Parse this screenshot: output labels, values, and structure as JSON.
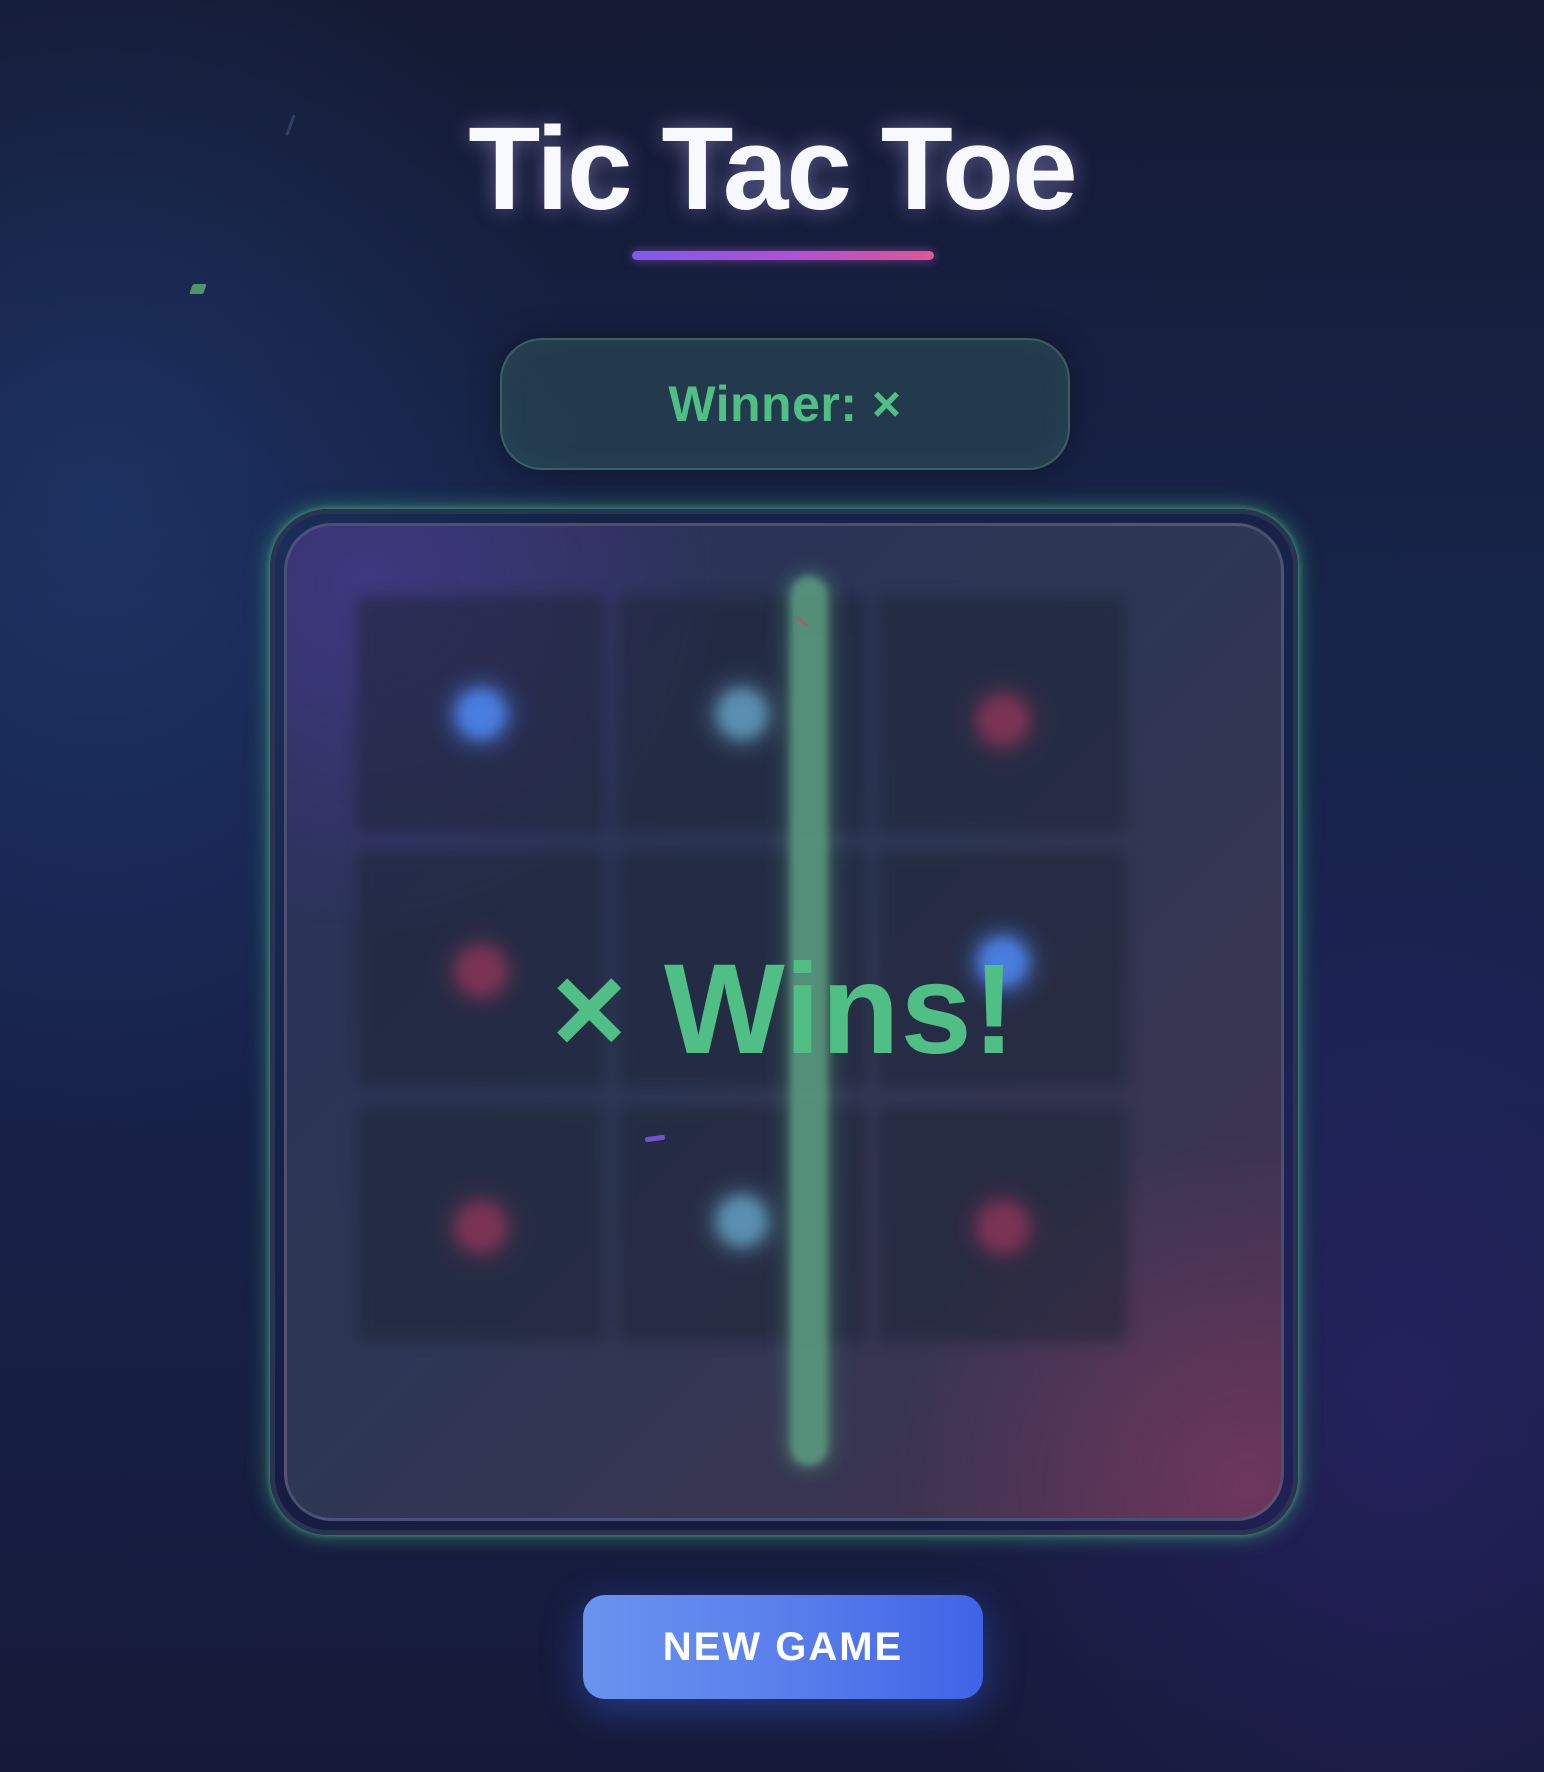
{
  "header": {
    "title": "Tic Tac Toe"
  },
  "status": {
    "text": "Winner: ×"
  },
  "board": {
    "cells": [
      "X",
      "X",
      "O",
      "O",
      "X",
      "X",
      "O",
      "X",
      "O"
    ],
    "winning_column": 2,
    "overlay_text": "× Wins!"
  },
  "controls": {
    "new_game_label": "NEW GAME"
  },
  "colors": {
    "win_green": "#4fbf85",
    "x_blue": "#4a7de0",
    "o_red": "#7a3355",
    "button_blue": "#5a7fec"
  }
}
